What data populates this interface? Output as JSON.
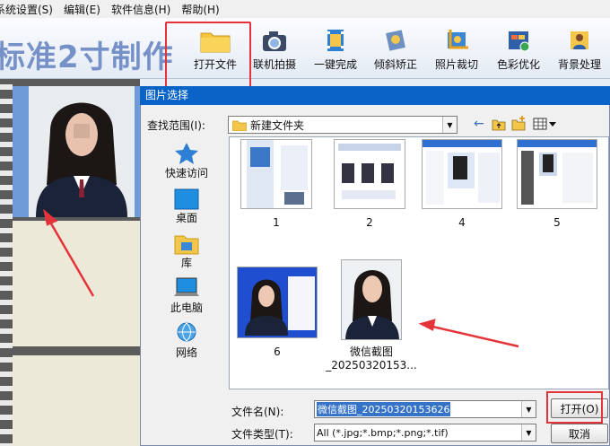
{
  "menubar": {
    "items": [
      "系统设置(S)",
      "编辑(E)",
      "软件信息(H)",
      "帮助(H)"
    ]
  },
  "app": {
    "title": "标准2寸制作"
  },
  "toolbar": {
    "buttons": [
      "打开文件",
      "联机拍摄",
      "一键完成",
      "倾斜矫正",
      "照片裁切",
      "色彩优化",
      "背景处理"
    ]
  },
  "dialog": {
    "title": "图片选择",
    "lookin_label": "查找范围(I):",
    "lookin_value": "新建文件夹",
    "places": [
      "快速访问",
      "桌面",
      "库",
      "此电脑",
      "网络"
    ],
    "files": [
      {
        "name": "1"
      },
      {
        "name": "2"
      },
      {
        "name": "4"
      },
      {
        "name": "5"
      },
      {
        "name": "6"
      },
      {
        "name": "微信截图",
        "name2": "_20250320153..."
      }
    ],
    "filename_label": "文件名(N):",
    "filename_value": "微信截图_20250320153626",
    "filetype_label": "文件类型(T):",
    "filetype_value": "All (*.jpg;*.bmp;*.png;*.tif)",
    "open_button": "打开(O)",
    "cancel_button": "取消"
  },
  "colors": {
    "accent": "#0a64c8",
    "highlight": "#e5333a",
    "title_text": "#7690c8"
  }
}
